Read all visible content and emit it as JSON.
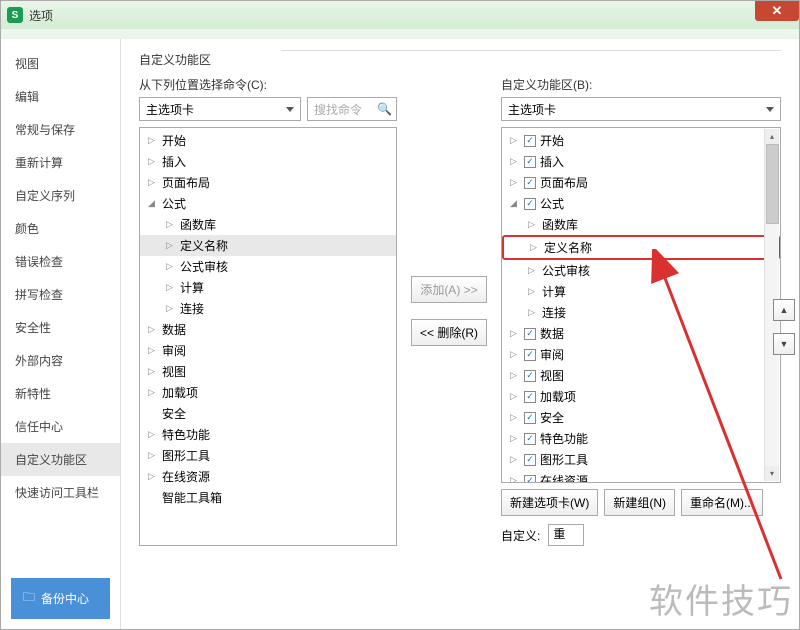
{
  "window": {
    "title": "选项"
  },
  "sidebar": {
    "items": [
      "视图",
      "编辑",
      "常规与保存",
      "重新计算",
      "自定义序列",
      "颜色",
      "错误检查",
      "拼写检查",
      "安全性",
      "外部内容",
      "新特性",
      "信任中心",
      "自定义功能区",
      "快速访问工具栏"
    ],
    "selected": 12,
    "backup": "备份中心"
  },
  "main": {
    "group_title": "自定义功能区",
    "left": {
      "label": "从下列位置选择命令(C):",
      "dropdown": "主选项卡",
      "search_placeholder": "搜找命令",
      "tree": [
        {
          "level": 0,
          "toggle": "▷",
          "label": "开始"
        },
        {
          "level": 0,
          "toggle": "▷",
          "label": "插入"
        },
        {
          "level": 0,
          "toggle": "▷",
          "label": "页面布局"
        },
        {
          "level": 0,
          "toggle": "◢",
          "label": "公式"
        },
        {
          "level": 1,
          "toggle": "▷",
          "label": "函数库"
        },
        {
          "level": 1,
          "toggle": "▷",
          "label": "定义名称",
          "selected": true
        },
        {
          "level": 1,
          "toggle": "▷",
          "label": "公式审核"
        },
        {
          "level": 1,
          "toggle": "▷",
          "label": "计算"
        },
        {
          "level": 1,
          "toggle": "▷",
          "label": "连接"
        },
        {
          "level": 0,
          "toggle": "▷",
          "label": "数据"
        },
        {
          "level": 0,
          "toggle": "▷",
          "label": "审阅"
        },
        {
          "level": 0,
          "toggle": "▷",
          "label": "视图"
        },
        {
          "level": 0,
          "toggle": "▷",
          "label": "加载项"
        },
        {
          "level": 0,
          "toggle": "",
          "label": "安全"
        },
        {
          "level": 0,
          "toggle": "▷",
          "label": "特色功能"
        },
        {
          "level": 0,
          "toggle": "▷",
          "label": "图形工具"
        },
        {
          "level": 0,
          "toggle": "▷",
          "label": "在线资源"
        },
        {
          "level": 0,
          "toggle": "",
          "label": "智能工具箱"
        }
      ]
    },
    "mid": {
      "add": "添加(A) >>",
      "remove": "<< 删除(R)"
    },
    "right": {
      "label": "自定义功能区(B):",
      "dropdown": "主选项卡",
      "tree": [
        {
          "level": 0,
          "toggle": "▷",
          "chk": true,
          "label": "开始"
        },
        {
          "level": 0,
          "toggle": "▷",
          "chk": true,
          "label": "插入"
        },
        {
          "level": 0,
          "toggle": "▷",
          "chk": true,
          "label": "页面布局"
        },
        {
          "level": 0,
          "toggle": "◢",
          "chk": true,
          "label": "公式"
        },
        {
          "level": 1,
          "toggle": "▷",
          "label": "函数库"
        },
        {
          "level": 1,
          "toggle": "▷",
          "label": "定义名称",
          "highlight": true
        },
        {
          "level": 1,
          "toggle": "▷",
          "label": "公式审核"
        },
        {
          "level": 1,
          "toggle": "▷",
          "label": "计算"
        },
        {
          "level": 1,
          "toggle": "▷",
          "label": "连接"
        },
        {
          "level": 0,
          "toggle": "▷",
          "chk": true,
          "label": "数据"
        },
        {
          "level": 0,
          "toggle": "▷",
          "chk": true,
          "label": "审阅"
        },
        {
          "level": 0,
          "toggle": "▷",
          "chk": true,
          "label": "视图"
        },
        {
          "level": 0,
          "toggle": "▷",
          "chk": true,
          "label": "加载项"
        },
        {
          "level": 0,
          "toggle": "▷",
          "chk": true,
          "label": "安全"
        },
        {
          "level": 0,
          "toggle": "▷",
          "chk": true,
          "label": "特色功能"
        },
        {
          "level": 0,
          "toggle": "▷",
          "chk": true,
          "label": "图形工具"
        },
        {
          "level": 0,
          "toggle": "▷",
          "chk": true,
          "label": "在线资源"
        }
      ],
      "buttons": {
        "new_tab": "新建选项卡(W)",
        "new_group": "新建组(N)",
        "rename": "重命名(M)..."
      },
      "custom_label": "自定义:",
      "custom_value": "重"
    }
  },
  "watermark": "软件技巧"
}
